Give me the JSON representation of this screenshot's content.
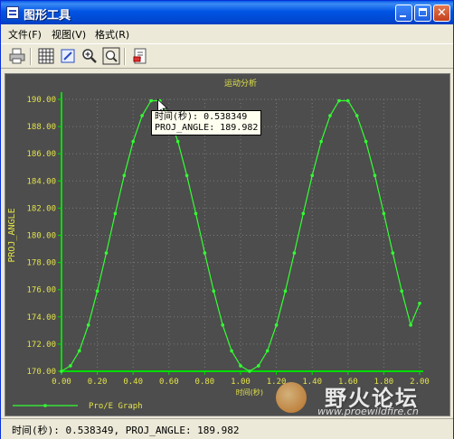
{
  "window": {
    "title": "图形工具"
  },
  "menu": [
    {
      "label": "文件(F)"
    },
    {
      "label": "视图(V)"
    },
    {
      "label": "格式(R)"
    }
  ],
  "toolbar": [
    "print-icon",
    "grid-icon",
    "edit-axis-icon",
    "zoom-in-icon",
    "zoom-fit-icon",
    "export-icon"
  ],
  "tooltip": {
    "line1": "时间(秒): 0.538349",
    "line2": "PROJ_ANGLE: 189.982"
  },
  "status": {
    "text": "时间(秒): 0.538349, PROJ_ANGLE: 189.982"
  },
  "watermark": {
    "name": "野火论坛",
    "url": "www.proewildfire.cn"
  },
  "colors": {
    "plot_bg": "#4d4d4d",
    "curve": "#33ff33",
    "axis": "#00dd00",
    "label": "#e3e34a",
    "grid": "#7a7a7a"
  },
  "chart_data": {
    "type": "line",
    "title": "运动分析",
    "xlabel": "时间(秒)",
    "ylabel": "PROJ_ANGLE",
    "xlim": [
      0,
      2
    ],
    "ylim": [
      170,
      190
    ],
    "grid": true,
    "legend": "bottom-left",
    "x_ticks": [
      "0.00",
      "0.20",
      "0.40",
      "0.60",
      "0.80",
      "1.00",
      "1.20",
      "1.40",
      "1.60",
      "1.80",
      "2.00"
    ],
    "y_ticks": [
      "170.00",
      "172.00",
      "174.00",
      "176.00",
      "178.00",
      "180.00",
      "182.00",
      "184.00",
      "186.00",
      "188.00",
      "190.00"
    ],
    "series": [
      {
        "name": "Pro/E Graph",
        "x": [
          0.0,
          0.05,
          0.1,
          0.15,
          0.2,
          0.25,
          0.3,
          0.35,
          0.4,
          0.45,
          0.5,
          0.55,
          0.6,
          0.65,
          0.7,
          0.75,
          0.8,
          0.85,
          0.9,
          0.95,
          1.0,
          1.05,
          1.1,
          1.15,
          1.2,
          1.25,
          1.3,
          1.35,
          1.4,
          1.45,
          1.5,
          1.55,
          1.6,
          1.65,
          1.7,
          1.75,
          1.8,
          1.85,
          1.9,
          1.95,
          2.0
        ],
        "y": [
          170.0,
          170.4,
          171.5,
          173.4,
          175.9,
          178.7,
          181.6,
          184.4,
          186.9,
          188.8,
          189.9,
          189.9,
          188.8,
          186.9,
          184.4,
          181.6,
          178.7,
          175.9,
          173.4,
          171.5,
          170.4,
          170.0,
          170.4,
          171.5,
          173.4,
          175.9,
          178.7,
          181.6,
          184.4,
          186.9,
          188.8,
          189.9,
          189.9,
          188.8,
          186.9,
          184.4,
          181.6,
          178.7,
          175.9,
          173.4,
          175.0
        ]
      }
    ]
  }
}
